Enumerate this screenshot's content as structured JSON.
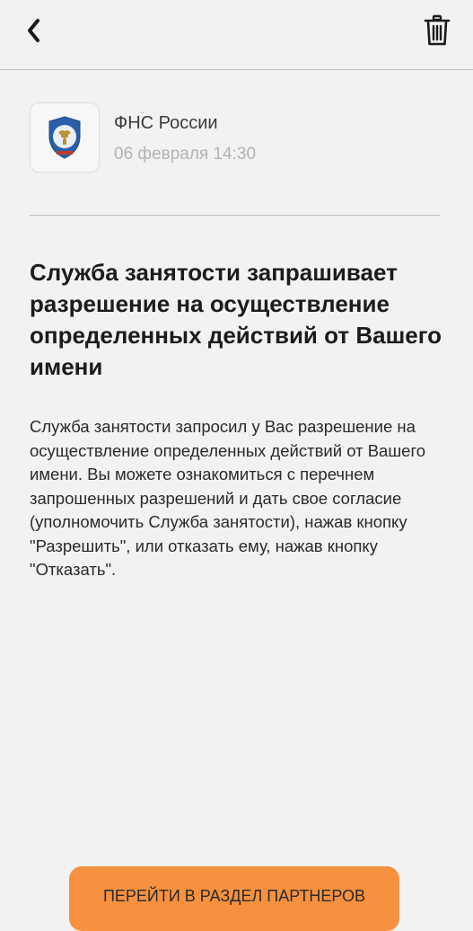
{
  "header": {
    "back_icon": "chevron-left-icon",
    "delete_icon": "trash-icon"
  },
  "message": {
    "sender_logo": "fns-emblem",
    "sender_name": "ФНС России",
    "date": "06 февраля 14:30",
    "title": "Служба занятости запрашивает разрешение на осуществление определенных действий от Вашего имени",
    "body": "Служба занятости запросил у Вас разрешение на осуществление определенных действий от Вашего имени. Вы можете ознакомиться с перечнем запрошенных разрешений и дать свое согласие (уполномочить Служба занятости), нажав кнопку \"Разрешить\", или отказать ему, нажав кнопку \"Отказать\"."
  },
  "actions": {
    "partners_label": "ПЕРЕЙТИ В РАЗДЕЛ ПАРТНЕРОВ"
  },
  "colors": {
    "background": "#f2f2f2",
    "accent": "#f7913f",
    "muted_text": "#b3b3b3"
  }
}
